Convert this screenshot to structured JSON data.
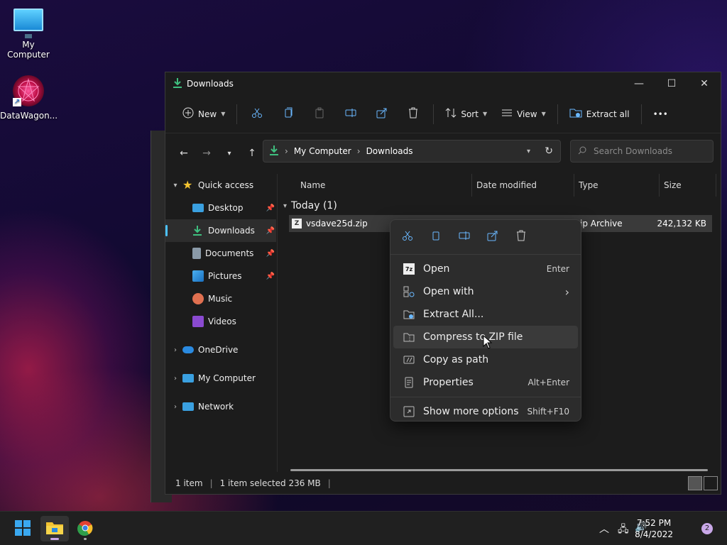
{
  "desktop": {
    "icons": [
      {
        "label": "My Computer"
      },
      {
        "label": "DataWagon..."
      }
    ]
  },
  "window": {
    "title": "Downloads",
    "controls": {
      "minimize": "—",
      "maximize": "☐",
      "close": "✕"
    }
  },
  "toolbar": {
    "new_label": "New",
    "sort_label": "Sort",
    "view_label": "View",
    "extract_label": "Extract all",
    "more_label": "•••"
  },
  "address": {
    "crumbs": [
      "My Computer",
      "Downloads"
    ],
    "search_placeholder": "Search Downloads"
  },
  "sidebar": {
    "quick_access": "Quick access",
    "items": [
      {
        "label": "Desktop",
        "pinned": true
      },
      {
        "label": "Downloads",
        "pinned": true
      },
      {
        "label": "Documents",
        "pinned": true
      },
      {
        "label": "Pictures",
        "pinned": true
      },
      {
        "label": "Music",
        "pinned": false
      },
      {
        "label": "Videos",
        "pinned": false
      }
    ],
    "onedrive": "OneDrive",
    "mycomputer": "My Computer",
    "network": "Network"
  },
  "columns": {
    "name": "Name",
    "date": "Date modified",
    "type": "Type",
    "size": "Size"
  },
  "group": {
    "label": "Today (1)"
  },
  "file": {
    "name": "vsdave25d.zip",
    "type": "ip Archive",
    "size": "242,132 KB"
  },
  "context_menu": {
    "items": [
      {
        "label": "Open",
        "shortcut": "Enter"
      },
      {
        "label": "Open with",
        "shortcut": "›"
      },
      {
        "label": "Extract All...",
        "shortcut": ""
      },
      {
        "label": "Compress to ZIP file",
        "shortcut": ""
      },
      {
        "label": "Copy as path",
        "shortcut": ""
      },
      {
        "label": "Properties",
        "shortcut": "Alt+Enter"
      }
    ],
    "more": {
      "label": "Show more options",
      "shortcut": "Shift+F10"
    }
  },
  "status": {
    "count": "1 item",
    "selected": "1 item selected  236 MB"
  },
  "taskbar": {
    "time": "7:52 PM",
    "date": "8/4/2022",
    "notifications": "2"
  },
  "colors": {
    "accent": "#4cc2ff",
    "window_bg": "#1c1c1c",
    "menu_bg": "#2c2c2c"
  }
}
